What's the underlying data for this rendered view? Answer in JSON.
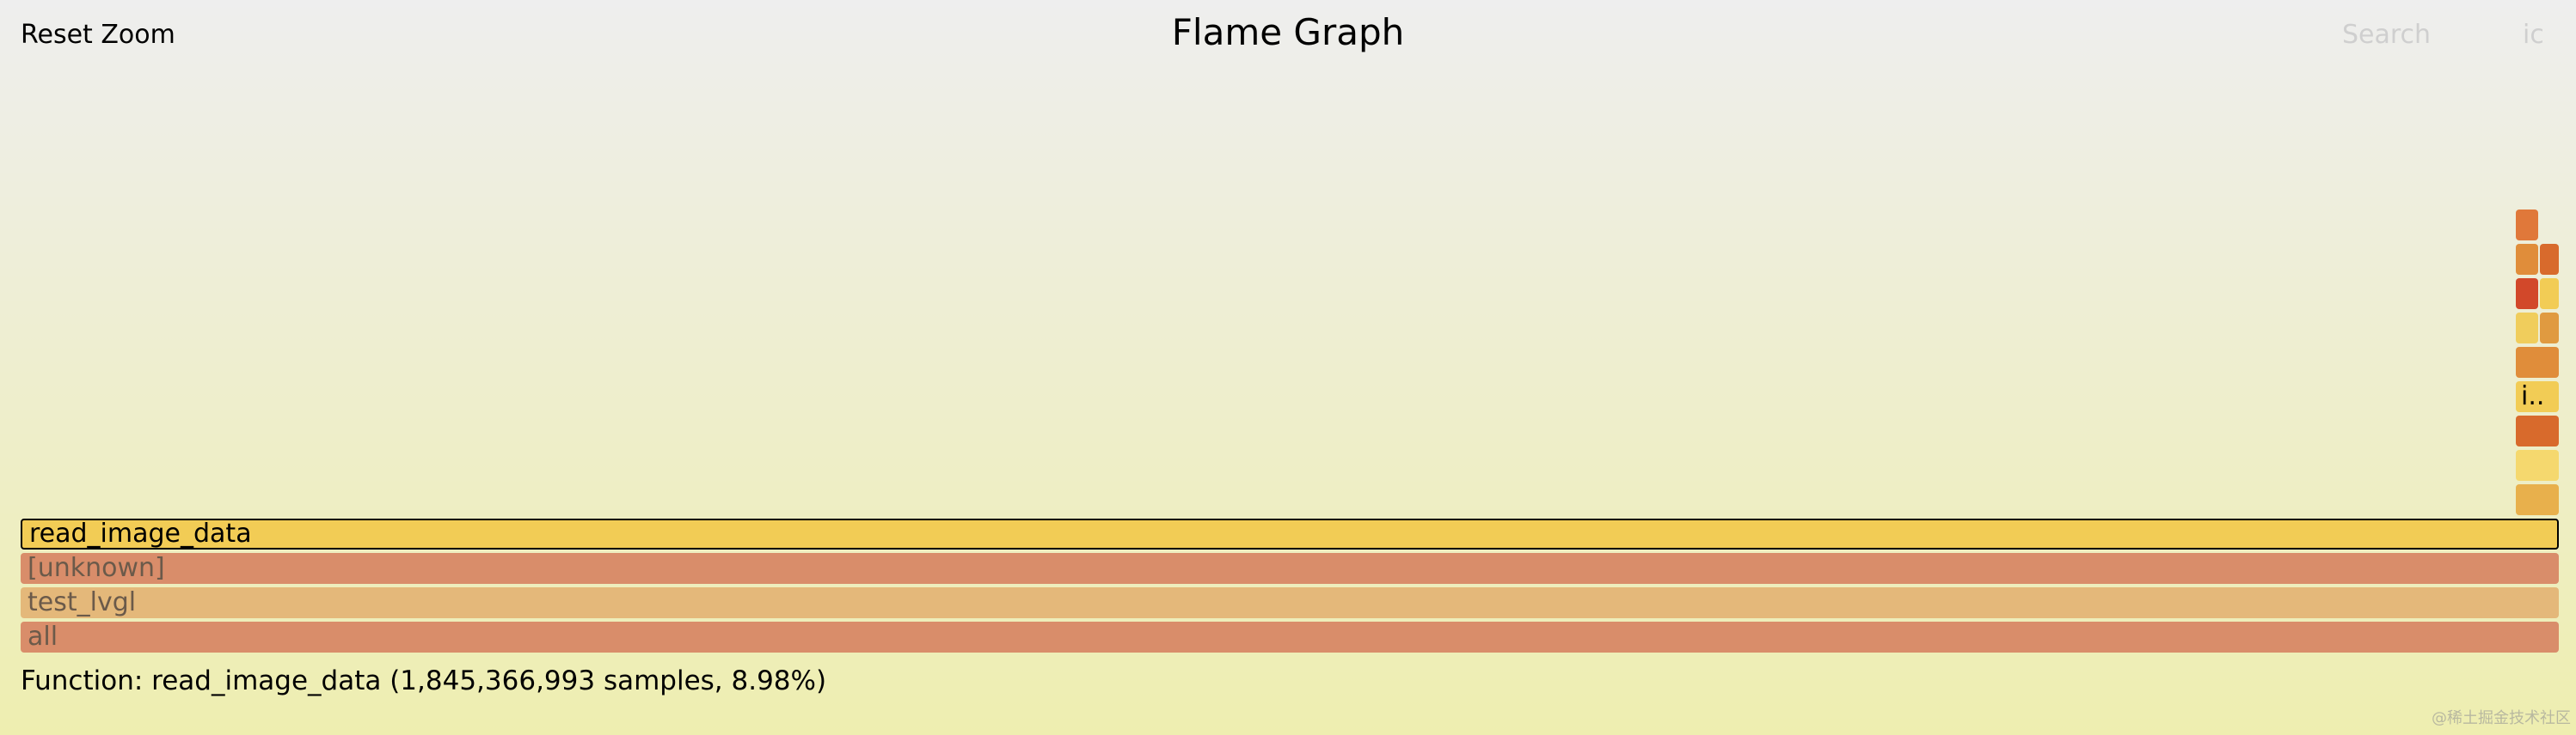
{
  "toolbar": {
    "reset_zoom_label": "Reset Zoom",
    "title": "Flame Graph",
    "search_label": "Search",
    "ic_label": "ic"
  },
  "frames": {
    "all": {
      "label": "all",
      "color": "#d98d6a"
    },
    "test_lvgl": {
      "label": "test_lvgl",
      "color": "#e4b87a"
    },
    "unknown": {
      "label": "[unknown]",
      "color": "#d98d6a"
    },
    "read_image_data": {
      "label": "read_image_data",
      "color": "#f2cc55"
    },
    "small_stack": [
      {
        "color": "#e8b04c"
      },
      {
        "color": "#f5d86e"
      },
      {
        "color": "#d86a2c"
      },
      {
        "label": "i..",
        "color": "#f2cc55"
      },
      {
        "color": "#e08d3a"
      },
      {
        "color": "#f0cd5c"
      },
      {
        "color": "#e09a40"
      },
      {
        "color": "#d2482a"
      },
      {
        "color": "#f2cc55"
      },
      {
        "color": "#e08d3a"
      },
      {
        "color": "#d86a2c"
      },
      {
        "color": "#e0783a"
      }
    ]
  },
  "status": {
    "text": "Function: read_image_data (1,845,366,993 samples, 8.98%)"
  },
  "watermark": {
    "text": "@稀土掘金技术社区"
  }
}
